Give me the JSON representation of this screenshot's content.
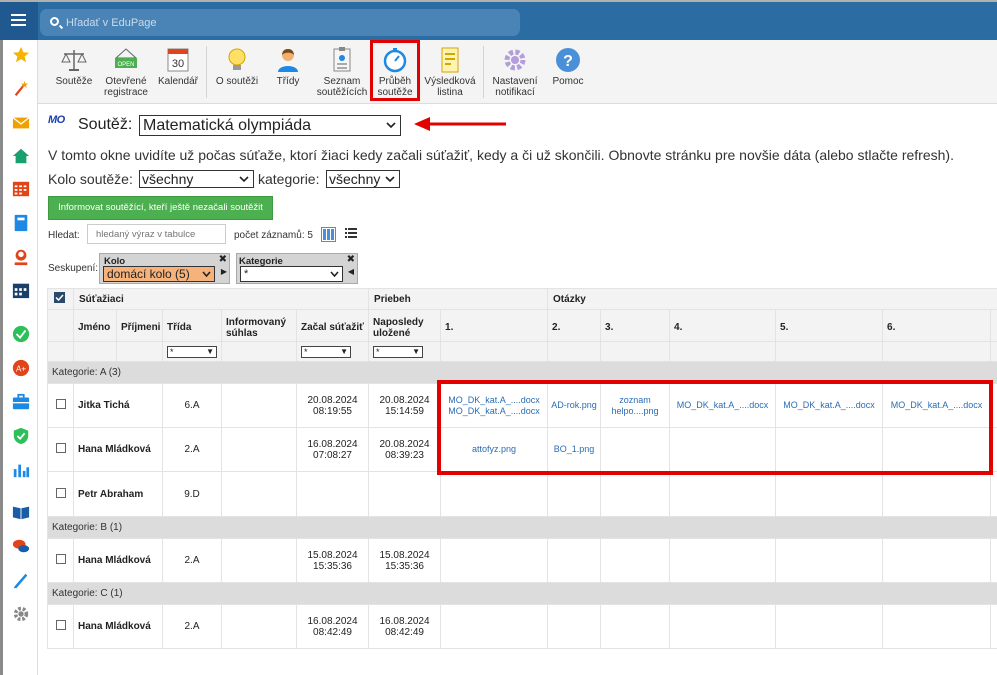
{
  "search": {
    "placeholder": "Hľadať v EduPage"
  },
  "toolbar": {
    "items": [
      {
        "label": "Soutěže"
      },
      {
        "label": "Otevřené registrace"
      },
      {
        "label": "Kalendář",
        "date": "30"
      },
      {
        "label": "O soutěži"
      },
      {
        "label": "Třídy"
      },
      {
        "label": "Seznam soutěžících"
      },
      {
        "label": "Průběh soutěže"
      },
      {
        "label": "Výsledková listina"
      },
      {
        "label": "Nastavení notifikací"
      },
      {
        "label": "Pomoc"
      }
    ],
    "open_badge": "OPEN"
  },
  "competition": {
    "logo": "MO",
    "label": "Soutěž:",
    "selected": "Matematická olympiáda"
  },
  "info_text": "V tomto okne uvidíte už počas súťaže, ktorí žiaci kedy začali súťažiť, kedy a či už skončili. Obnovte stránku pre novšie dáta (alebo stlačte refresh).",
  "filters": {
    "round_label": "Kolo soutěže:",
    "round_value": "všechny",
    "category_label": "kategorie:",
    "category_value": "všechny"
  },
  "inform_button": "Informovat soutěžící, kteří ještě nezačali soutěžit",
  "table_search": {
    "label": "Hledat:",
    "placeholder": "hledaný výraz v tabulce",
    "count_label": "počet záznamů: 5"
  },
  "grouping": {
    "label": "Seskupení:",
    "chips": [
      {
        "title": "Kolo",
        "value": "domácí kolo (5)"
      },
      {
        "title": "Kategorie",
        "value": "*"
      }
    ]
  },
  "table": {
    "groups_top": {
      "students": "Súťažiaci",
      "progress": "Priebeh",
      "questions": "Otázky"
    },
    "columns": [
      "Jméno",
      "Příjmeni",
      "Třída",
      "Informovaný súhlas",
      "Začal súťažiť",
      "Naposledy uložené",
      "1.",
      "2.",
      "3.",
      "4.",
      "5.",
      "6."
    ],
    "filter_value": "*",
    "categories": [
      {
        "label": "Kategorie: A",
        "count": "(3)",
        "rows": [
          {
            "name": "Jitka Tichá",
            "class": "6.A",
            "started": "20.08.2024",
            "started_time": "08:19:55",
            "saved": "20.08.2024",
            "saved_time": "15:14:59",
            "q": [
              "MO_DK_kat.A_....docx MO_DK_kat.A_....docx",
              "AD-rok.png",
              "zoznam helpo....png",
              "MO_DK_kat.A_....docx",
              "MO_DK_kat.A_....docx",
              "MO_DK_kat.A_....docx"
            ]
          },
          {
            "name": "Hana Mládková",
            "class": "2.A",
            "started": "16.08.2024",
            "started_time": "07:08:27",
            "saved": "20.08.2024",
            "saved_time": "08:39:23",
            "q": [
              "attofyz.png",
              "BO_1.png",
              "",
              "",
              "",
              ""
            ]
          },
          {
            "name": "Petr Abraham",
            "class": "9.D",
            "started": "",
            "started_time": "",
            "saved": "",
            "saved_time": "",
            "q": [
              "",
              "",
              "",
              "",
              "",
              ""
            ]
          }
        ]
      },
      {
        "label": "Kategorie: B",
        "count": "(1)",
        "rows": [
          {
            "name": "Hana Mládková",
            "class": "2.A",
            "started": "15.08.2024",
            "started_time": "15:35:36",
            "saved": "15.08.2024",
            "saved_time": "15:35:36",
            "q": [
              "",
              "",
              "",
              "",
              "",
              ""
            ]
          }
        ]
      },
      {
        "label": "Kategorie: C",
        "count": "(1)",
        "rows": [
          {
            "name": "Hana Mládková",
            "class": "2.A",
            "started": "16.08.2024",
            "started_time": "08:42:49",
            "saved": "16.08.2024",
            "saved_time": "08:42:49",
            "q": [
              "",
              "",
              "",
              "",
              "",
              ""
            ]
          }
        ]
      }
    ]
  },
  "colors": {
    "topbar": "#2b6ca3",
    "accent_green": "#4caf50",
    "highlight_red": "#e30000",
    "link": "#2a6db4"
  }
}
